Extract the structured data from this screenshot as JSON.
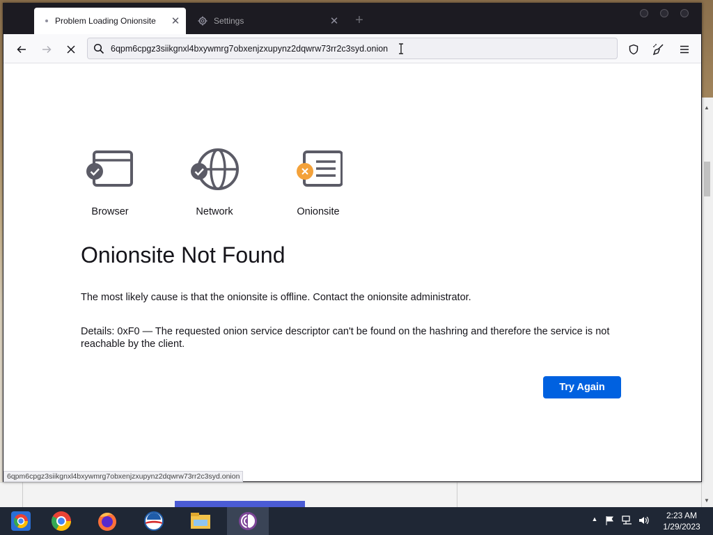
{
  "browser": {
    "tabs": [
      {
        "label": "Problem Loading Onionsite",
        "active": true
      },
      {
        "label": "Settings",
        "active": false
      }
    ],
    "url": "6qpm6cpgz3siikgnxl4bxywmrg7obxenjzxupynz2dqwrw73rr2c3syd.onion",
    "status_url": "6qpm6cpgz3siikgnxl4bxywmrg7obxenjzxupynz2dqwrw73rr2c3syd.onion"
  },
  "error_page": {
    "stages": [
      {
        "label": "Browser",
        "icon": "browser-icon",
        "status": "ok"
      },
      {
        "label": "Network",
        "icon": "globe-icon",
        "status": "ok"
      },
      {
        "label": "Onionsite",
        "icon": "onionsite-icon",
        "status": "error"
      }
    ],
    "title": "Onionsite Not Found",
    "message": "The most likely cause is that the onionsite is offline. Contact the onionsite administrator.",
    "details": "Details: 0xF0 — The requested onion service descriptor can't be found on the hashring and therefore the service is not reachable by the client.",
    "try_again_label": "Try Again"
  },
  "taskbar": {
    "apps": [
      "chrome-os-icon",
      "chrome-icon",
      "firefox-icon",
      "obama-icon",
      "file-explorer-icon",
      "tor-browser-icon"
    ],
    "time": "2:23 AM",
    "date": "1/29/2023"
  },
  "colors": {
    "ok": "#5b5b66",
    "error": "#f4a23a",
    "primary_button": "#0061e0"
  }
}
